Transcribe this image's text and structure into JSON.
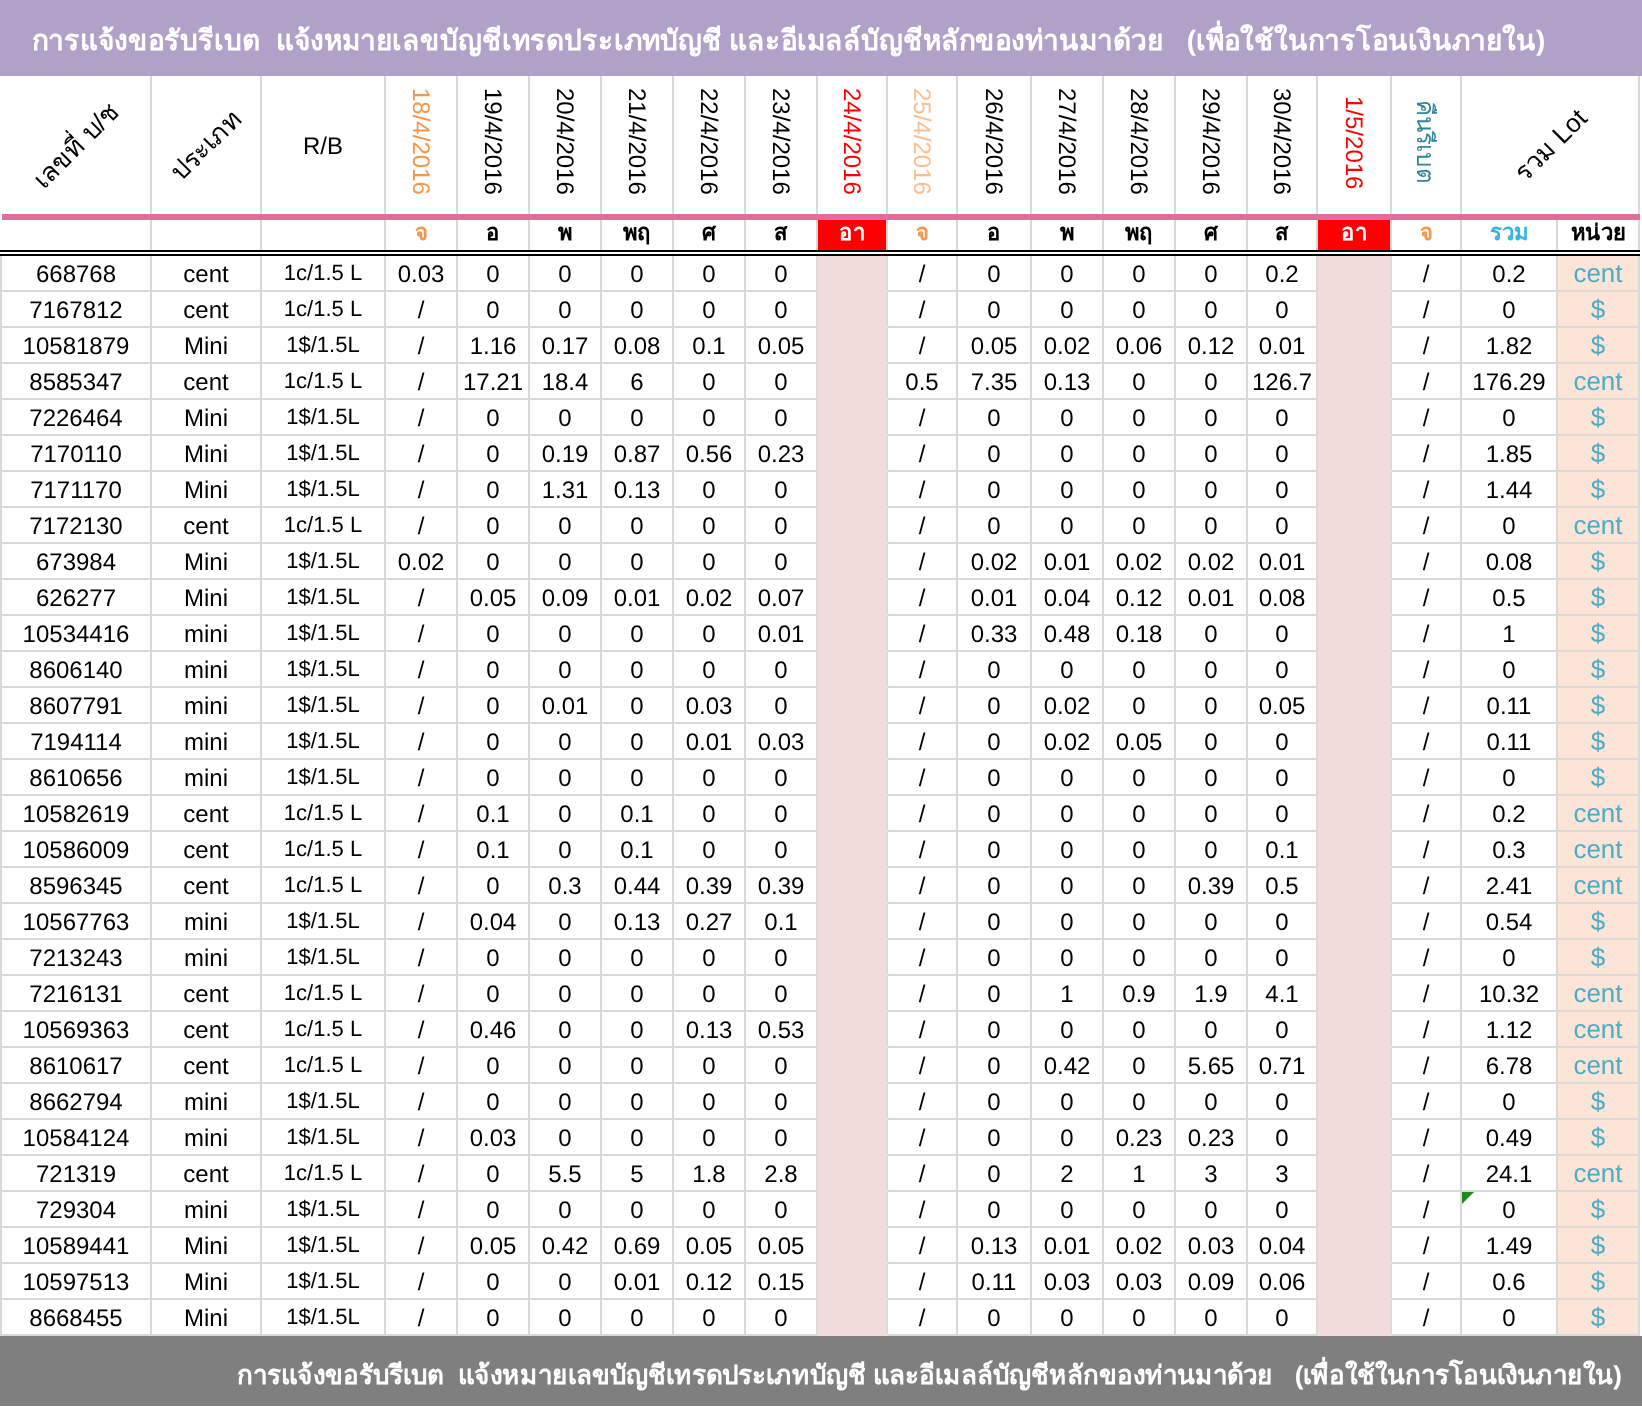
{
  "title": "การแจ้งขอรับรีเบต  แจ้งหมายเลขบัญชีเทรดประเภทบัญชี และอีเมลล์บัญชีหลักของท่านมาด้วย   (เพื่อใช้ในการโอนเงินภายใน)",
  "columns": [
    {
      "kind": "account",
      "header": "เลขที่ บ/ช"
    },
    {
      "kind": "type",
      "header": "ประเภท"
    },
    {
      "kind": "rb",
      "header": "R/B"
    },
    {
      "kind": "day",
      "header": "18/4/2016",
      "color": "#f79646",
      "day": {
        "label": "จ",
        "color": "#f79646",
        "highlighted": false
      }
    },
    {
      "kind": "day",
      "header": "19/4/2016",
      "color": "#000000",
      "day": {
        "label": "อ",
        "color": "#000000",
        "highlighted": false
      }
    },
    {
      "kind": "day",
      "header": "20/4/2016",
      "color": "#000000",
      "day": {
        "label": "พ",
        "color": "#000000",
        "highlighted": false
      }
    },
    {
      "kind": "day",
      "header": "21/4/2016",
      "color": "#000000",
      "day": {
        "label": "พฤ",
        "color": "#000000",
        "highlighted": false
      }
    },
    {
      "kind": "day",
      "header": "22/4/2016",
      "color": "#000000",
      "day": {
        "label": "ศ",
        "color": "#000000",
        "highlighted": false
      }
    },
    {
      "kind": "day",
      "header": "23/4/2016",
      "color": "#000000",
      "day": {
        "label": "ส",
        "color": "#000000",
        "highlighted": false
      }
    },
    {
      "kind": "holiday",
      "header": "24/4/2016",
      "color": "#ff0000",
      "day": {
        "label": "อา",
        "color": "#ff0000",
        "highlighted": true
      }
    },
    {
      "kind": "day",
      "header": "25/4/2016",
      "color": "#fabf8f",
      "day": {
        "label": "จ",
        "color": "#f79646",
        "highlighted": false
      }
    },
    {
      "kind": "day",
      "header": "26/4/2016",
      "color": "#000000",
      "day": {
        "label": "อ",
        "color": "#000000",
        "highlighted": false
      }
    },
    {
      "kind": "day",
      "header": "27/4/2016",
      "color": "#000000",
      "day": {
        "label": "พ",
        "color": "#000000",
        "highlighted": false
      }
    },
    {
      "kind": "day",
      "header": "28/4/2016",
      "color": "#000000",
      "day": {
        "label": "พฤ",
        "color": "#000000",
        "highlighted": false
      }
    },
    {
      "kind": "day",
      "header": "29/4/2016",
      "color": "#000000",
      "day": {
        "label": "ศ",
        "color": "#000000",
        "highlighted": false
      }
    },
    {
      "kind": "day",
      "header": "30/4/2016",
      "color": "#000000",
      "day": {
        "label": "ส",
        "color": "#000000",
        "highlighted": false
      }
    },
    {
      "kind": "holiday",
      "header": "1/5/2016",
      "color": "#ff0000",
      "day": {
        "label": "อา",
        "color": "#ff0000",
        "highlighted": true
      }
    },
    {
      "kind": "rebate",
      "header": "คืนรีเบต",
      "color": "#31869b",
      "day": {
        "label": "จ",
        "color": "#f79646",
        "highlighted": false
      }
    },
    {
      "kind": "total",
      "header": "รวม Lot",
      "day": {
        "label": "รวม",
        "color": "#33b5e5",
        "highlighted": false
      }
    },
    {
      "kind": "unit",
      "day": {
        "label": "หน่วย",
        "color": "#000000",
        "highlighted": false
      }
    }
  ],
  "rows": [
    {
      "account": "668768",
      "type": "cent",
      "rb": "1c/1.5 L",
      "days": [
        "0.03",
        "0",
        "0",
        "0",
        "0",
        "0",
        "/",
        "0",
        "0",
        "0",
        "0",
        "0.2"
      ],
      "rebate": "/",
      "total": "0.2",
      "unit": "cent",
      "flagged": false
    },
    {
      "account": "7167812",
      "type": "cent",
      "rb": "1c/1.5 L",
      "days": [
        "/",
        "0",
        "0",
        "0",
        "0",
        "0",
        "/",
        "0",
        "0",
        "0",
        "0",
        "0"
      ],
      "rebate": "/",
      "total": "0",
      "unit": "$",
      "flagged": false
    },
    {
      "account": "10581879",
      "type": "Mini",
      "rb": "1$/1.5L",
      "days": [
        "/",
        "1.16",
        "0.17",
        "0.08",
        "0.1",
        "0.05",
        "/",
        "0.05",
        "0.02",
        "0.06",
        "0.12",
        "0.01"
      ],
      "rebate": "/",
      "total": "1.82",
      "unit": "$",
      "flagged": false
    },
    {
      "account": "8585347",
      "type": "cent",
      "rb": "1c/1.5 L",
      "days": [
        "/",
        "17.21",
        "18.4",
        "6",
        "0",
        "0",
        "0.5",
        "7.35",
        "0.13",
        "0",
        "0",
        "126.7"
      ],
      "rebate": "/",
      "total": "176.29",
      "unit": "cent",
      "flagged": false
    },
    {
      "account": "7226464",
      "type": "Mini",
      "rb": "1$/1.5L",
      "days": [
        "/",
        "0",
        "0",
        "0",
        "0",
        "0",
        "/",
        "0",
        "0",
        "0",
        "0",
        "0"
      ],
      "rebate": "/",
      "total": "0",
      "unit": "$",
      "flagged": false
    },
    {
      "account": "7170110",
      "type": "Mini",
      "rb": "1$/1.5L",
      "days": [
        "/",
        "0",
        "0.19",
        "0.87",
        "0.56",
        "0.23",
        "/",
        "0",
        "0",
        "0",
        "0",
        "0"
      ],
      "rebate": "/",
      "total": "1.85",
      "unit": "$",
      "flagged": false
    },
    {
      "account": "7171170",
      "type": "Mini",
      "rb": "1$/1.5L",
      "days": [
        "/",
        "0",
        "1.31",
        "0.13",
        "0",
        "0",
        "/",
        "0",
        "0",
        "0",
        "0",
        "0"
      ],
      "rebate": "/",
      "total": "1.44",
      "unit": "$",
      "flagged": false
    },
    {
      "account": "7172130",
      "type": "cent",
      "rb": "1c/1.5 L",
      "days": [
        "/",
        "0",
        "0",
        "0",
        "0",
        "0",
        "/",
        "0",
        "0",
        "0",
        "0",
        "0"
      ],
      "rebate": "/",
      "total": "0",
      "unit": "cent",
      "flagged": false
    },
    {
      "account": "673984",
      "type": "Mini",
      "rb": "1$/1.5L",
      "days": [
        "0.02",
        "0",
        "0",
        "0",
        "0",
        "0",
        "/",
        "0.02",
        "0.01",
        "0.02",
        "0.02",
        "0.01"
      ],
      "rebate": "/",
      "total": "0.08",
      "unit": "$",
      "flagged": false
    },
    {
      "account": "626277",
      "type": "Mini",
      "rb": "1$/1.5L",
      "days": [
        "/",
        "0.05",
        "0.09",
        "0.01",
        "0.02",
        "0.07",
        "/",
        "0.01",
        "0.04",
        "0.12",
        "0.01",
        "0.08"
      ],
      "rebate": "/",
      "total": "0.5",
      "unit": "$",
      "flagged": false
    },
    {
      "account": "10534416",
      "type": "mini",
      "rb": "1$/1.5L",
      "days": [
        "/",
        "0",
        "0",
        "0",
        "0",
        "0.01",
        "/",
        "0.33",
        "0.48",
        "0.18",
        "0",
        "0"
      ],
      "rebate": "/",
      "total": "1",
      "unit": "$",
      "flagged": false
    },
    {
      "account": "8606140",
      "type": "mini",
      "rb": "1$/1.5L",
      "days": [
        "/",
        "0",
        "0",
        "0",
        "0",
        "0",
        "/",
        "0",
        "0",
        "0",
        "0",
        "0"
      ],
      "rebate": "/",
      "total": "0",
      "unit": "$",
      "flagged": false
    },
    {
      "account": "8607791",
      "type": "mini",
      "rb": "1$/1.5L",
      "days": [
        "/",
        "0",
        "0.01",
        "0",
        "0.03",
        "0",
        "/",
        "0",
        "0.02",
        "0",
        "0",
        "0.05"
      ],
      "rebate": "/",
      "total": "0.11",
      "unit": "$",
      "flagged": false
    },
    {
      "account": "7194114",
      "type": "mini",
      "rb": "1$/1.5L",
      "days": [
        "/",
        "0",
        "0",
        "0",
        "0.01",
        "0.03",
        "/",
        "0",
        "0.02",
        "0.05",
        "0",
        "0"
      ],
      "rebate": "/",
      "total": "0.11",
      "unit": "$",
      "flagged": false
    },
    {
      "account": "8610656",
      "type": "mini",
      "rb": "1$/1.5L",
      "days": [
        "/",
        "0",
        "0",
        "0",
        "0",
        "0",
        "/",
        "0",
        "0",
        "0",
        "0",
        "0"
      ],
      "rebate": "/",
      "total": "0",
      "unit": "$",
      "flagged": false
    },
    {
      "account": "10582619",
      "type": "cent",
      "rb": "1c/1.5 L",
      "days": [
        "/",
        "0.1",
        "0",
        "0.1",
        "0",
        "0",
        "/",
        "0",
        "0",
        "0",
        "0",
        "0"
      ],
      "rebate": "/",
      "total": "0.2",
      "unit": "cent",
      "flagged": false
    },
    {
      "account": "10586009",
      "type": "cent",
      "rb": "1c/1.5 L",
      "days": [
        "/",
        "0.1",
        "0",
        "0.1",
        "0",
        "0",
        "/",
        "0",
        "0",
        "0",
        "0",
        "0.1"
      ],
      "rebate": "/",
      "total": "0.3",
      "unit": "cent",
      "flagged": false
    },
    {
      "account": "8596345",
      "type": "cent",
      "rb": "1c/1.5 L",
      "days": [
        "/",
        "0",
        "0.3",
        "0.44",
        "0.39",
        "0.39",
        "/",
        "0",
        "0",
        "0",
        "0.39",
        "0.5"
      ],
      "rebate": "/",
      "total": "2.41",
      "unit": "cent",
      "flagged": false
    },
    {
      "account": "10567763",
      "type": "mini",
      "rb": "1$/1.5L",
      "days": [
        "/",
        "0.04",
        "0",
        "0.13",
        "0.27",
        "0.1",
        "/",
        "0",
        "0",
        "0",
        "0",
        "0"
      ],
      "rebate": "/",
      "total": "0.54",
      "unit": "$",
      "flagged": false
    },
    {
      "account": "7213243",
      "type": "mini",
      "rb": "1$/1.5L",
      "days": [
        "/",
        "0",
        "0",
        "0",
        "0",
        "0",
        "/",
        "0",
        "0",
        "0",
        "0",
        "0"
      ],
      "rebate": "/",
      "total": "0",
      "unit": "$",
      "flagged": false
    },
    {
      "account": "7216131",
      "type": "cent",
      "rb": "1c/1.5 L",
      "days": [
        "/",
        "0",
        "0",
        "0",
        "0",
        "0",
        "/",
        "0",
        "1",
        "0.9",
        "1.9",
        "4.1"
      ],
      "rebate": "/",
      "total": "10.32",
      "unit": "cent",
      "flagged": false
    },
    {
      "account": "10569363",
      "type": "cent",
      "rb": "1c/1.5 L",
      "days": [
        "/",
        "0.46",
        "0",
        "0",
        "0.13",
        "0.53",
        "/",
        "0",
        "0",
        "0",
        "0",
        "0"
      ],
      "rebate": "/",
      "total": "1.12",
      "unit": "cent",
      "flagged": false
    },
    {
      "account": "8610617",
      "type": "cent",
      "rb": "1c/1.5 L",
      "days": [
        "/",
        "0",
        "0",
        "0",
        "0",
        "0",
        "/",
        "0",
        "0.42",
        "0",
        "5.65",
        "0.71"
      ],
      "rebate": "/",
      "total": "6.78",
      "unit": "cent",
      "flagged": false
    },
    {
      "account": "8662794",
      "type": "mini",
      "rb": "1$/1.5L",
      "days": [
        "/",
        "0",
        "0",
        "0",
        "0",
        "0",
        "/",
        "0",
        "0",
        "0",
        "0",
        "0"
      ],
      "rebate": "/",
      "total": "0",
      "unit": "$",
      "flagged": false
    },
    {
      "account": "10584124",
      "type": "mini",
      "rb": "1$/1.5L",
      "days": [
        "/",
        "0.03",
        "0",
        "0",
        "0",
        "0",
        "/",
        "0",
        "0",
        "0.23",
        "0.23",
        "0"
      ],
      "rebate": "/",
      "total": "0.49",
      "unit": "$",
      "flagged": false
    },
    {
      "account": "721319",
      "type": "cent",
      "rb": "1c/1.5 L",
      "days": [
        "/",
        "0",
        "5.5",
        "5",
        "1.8",
        "2.8",
        "/",
        "0",
        "2",
        "1",
        "3",
        "3"
      ],
      "rebate": "/",
      "total": "24.1",
      "unit": "cent",
      "flagged": false
    },
    {
      "account": "729304",
      "type": "mini",
      "rb": "1$/1.5L",
      "days": [
        "/",
        "0",
        "0",
        "0",
        "0",
        "0",
        "/",
        "0",
        "0",
        "0",
        "0",
        "0"
      ],
      "rebate": "/",
      "total": "0",
      "unit": "$",
      "flagged": true
    },
    {
      "account": "10589441",
      "type": "Mini",
      "rb": "1$/1.5L",
      "days": [
        "/",
        "0.05",
        "0.42",
        "0.69",
        "0.05",
        "0.05",
        "/",
        "0.13",
        "0.01",
        "0.02",
        "0.03",
        "0.04"
      ],
      "rebate": "/",
      "total": "1.49",
      "unit": "$",
      "flagged": false
    },
    {
      "account": "10597513",
      "type": "Mini",
      "rb": "1$/1.5L",
      "days": [
        "/",
        "0",
        "0",
        "0.01",
        "0.12",
        "0.15",
        "/",
        "0.11",
        "0.03",
        "0.03",
        "0.09",
        "0.06"
      ],
      "rebate": "/",
      "total": "0.6",
      "unit": "$",
      "flagged": false
    },
    {
      "account": "8668455",
      "type": "Mini",
      "rb": "1$/1.5L",
      "days": [
        "/",
        "0",
        "0",
        "0",
        "0",
        "0",
        "/",
        "0",
        "0",
        "0",
        "0",
        "0"
      ],
      "rebate": "/",
      "total": "0",
      "unit": "$",
      "flagged": false
    }
  ],
  "footer": "การแจ้งขอรับรีเบต  แจ้งหมายเลขบัญชีเทรดประเภทบัญชี และอีเมลล์บัญชีหลักของท่านมาด้วย   (เพื่อใช้ในการโอนเงินภายใน)"
}
